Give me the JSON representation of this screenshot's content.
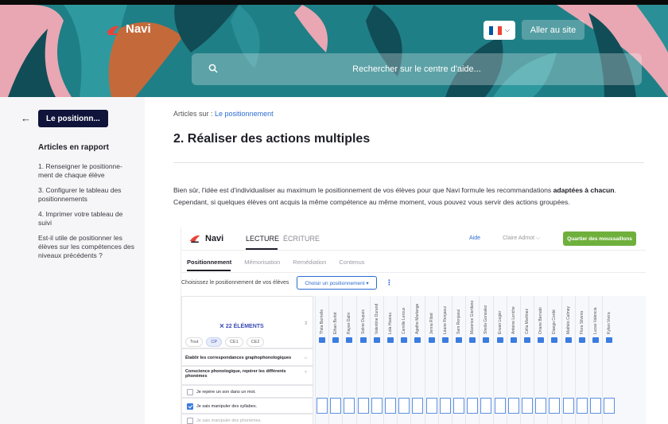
{
  "header": {
    "logo_text": "Navi",
    "language_flag_colors": [
      "#0055a4",
      "#ffffff",
      "#ef4135"
    ],
    "site_button_label": "Aller au site",
    "search_placeholder": "Rechercher sur le centre d'aide..."
  },
  "sidebar": {
    "back_pill_label": "Le positionn...",
    "related_title": "Articles en rapport",
    "related_items": [
      "1. Renseigner le positionne-ment de chaque élève",
      "3. Configurer le tableau des positionnements",
      "4. Imprimer votre tableau de suivi",
      "Est-il utile de positionner les élèves sur les compétences des niveaux précédents ?"
    ]
  },
  "article": {
    "breadcrumb_prefix": "Articles sur :",
    "breadcrumb_link": "Le positionnement",
    "title": "2. Réaliser des actions multiples",
    "body_part1": "Bien sûr, l'idée est d'individualiser au maximum le positionnement de vos élèves pour que Navi formule les recommandations ",
    "body_bold": "adaptées à chacun",
    "body_part2": ". Cependant, si quelques élèves ont acquis la même compétence au même moment, vous pouvez vous servir des actions groupées."
  },
  "app": {
    "logo_text": "Navi",
    "nav": {
      "lecture": "LECTURE",
      "ecriture": "ÉCRITURE"
    },
    "aide": "Aide",
    "user": "Claire Admot ⌵",
    "class_button": "Quartier des moussaillons",
    "subtabs": [
      "Positionnement",
      "Mémorisation",
      "Remédiation",
      "Contenus"
    ],
    "choose_label": "Choisissez le positionnement de vos élèves",
    "choose_button": "Choisir un positionnement ▾",
    "count_label": "22 ÉLÉMENTS",
    "chips": [
      "Tout",
      "CP",
      "CE1",
      "CE2"
    ],
    "students": [
      "Théa Barrielle",
      "Ethan Burlot",
      "Rayan Dalin",
      "Soline Dupuis",
      "Valentine Durand",
      "Lola Hoarau",
      "Camille Leroux",
      "Agathe Martange",
      "Jenna Ribot",
      "Léane Renjaoui",
      "Sam Renjaoui",
      "Maxence Giordano",
      "Sheila Gonzalez",
      "Erwan Legier",
      "Antoine Leriche",
      "Célia Martinez",
      "Oriane Bernabi",
      "Diaego Cordé",
      "Mathéo Calmey",
      "Flora Silveira",
      "Lucas Valencia",
      "Kylian Vieira"
    ],
    "rows": {
      "group1": "Établir les correspondances graphophonologiques",
      "group2": "Conscience phonologique, repérer les différents phonèmes",
      "item1": "Je repère un son dans un mot.",
      "item2": "Je sais manipuler des syllabes.",
      "item3": "Je sais manipuler des phonèmes."
    },
    "accent_color": "#3b7de0",
    "class_button_color": "#6fb03d"
  }
}
